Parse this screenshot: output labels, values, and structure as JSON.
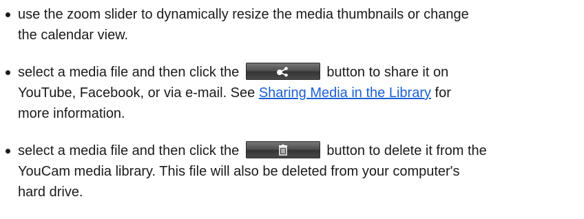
{
  "items": [
    {
      "line1": "use the zoom slider to dynamically resize the media thumbnails or change",
      "line2": "the calendar view."
    },
    {
      "before_button": "select a media file and then click the",
      "after_button": "button to share it on",
      "line2_before_link": "YouTube, Facebook, or via e-mail. See",
      "link_text": "Sharing Media in the Library",
      "line2_after_link": "for",
      "line3": "more information.",
      "button_icon": "share-icon"
    },
    {
      "before_button": "select a media file and then click the",
      "after_button": "button to delete it from the",
      "line2": "YouCam media library. This file will also be deleted from your computer's",
      "line3": "hard drive.",
      "button_icon": "trash-icon"
    }
  ],
  "colors": {
    "text": "#1a1a1a",
    "link": "#1a5fd6",
    "button_top": "#7a7a7a",
    "button_bottom": "#333333"
  }
}
